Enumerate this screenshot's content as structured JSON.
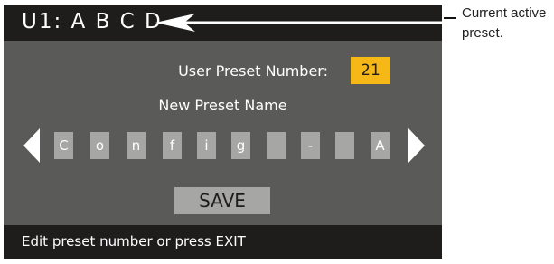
{
  "header": {
    "preset_title": "U1: A B C D"
  },
  "preset_number": {
    "label": "User Preset Number:",
    "value": "21"
  },
  "preset_name": {
    "label": "New Preset Name",
    "characters": [
      "C",
      "o",
      "n",
      "f",
      "i",
      "g",
      "",
      "-",
      "",
      "A"
    ]
  },
  "save_label": "SAVE",
  "status_text": "Edit preset number or press EXIT",
  "callout": {
    "line1": "Current active",
    "line2": "preset."
  },
  "icons": {
    "left": "left-arrow-icon",
    "right": "right-arrow-icon",
    "pointer": "pointer-arrow-icon"
  },
  "colors": {
    "screen_bg": "#5a5a58",
    "bar_bg": "#1f1c1c",
    "highlight": "#f5b817",
    "cell_bg": "#a6a6a5"
  }
}
